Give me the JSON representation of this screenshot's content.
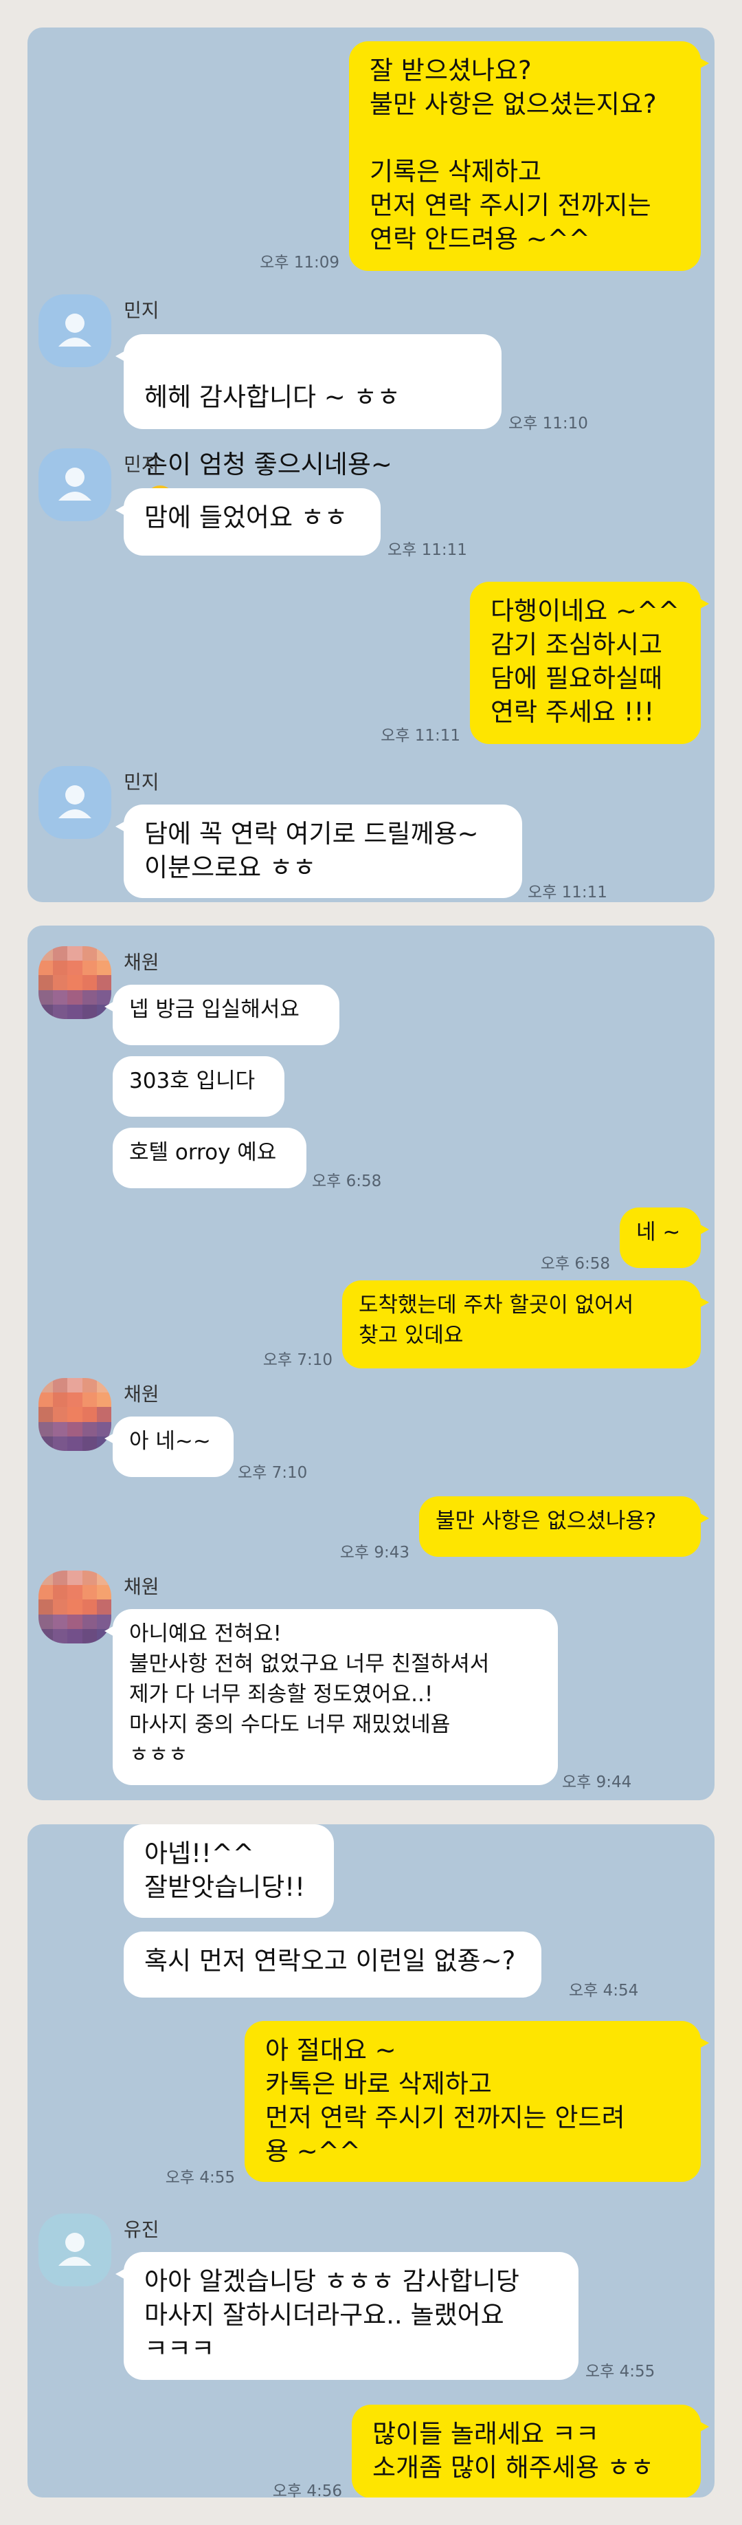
{
  "panel1": {
    "msg1": "잘 받으셨나요?\n불만 사항은 없으셨는지요?\n\n기록은 삭제하고\n먼저 연락 주시기 전까지는\n연락 안드려용 ~^^",
    "time1": "오후 11:09",
    "name1": "민지",
    "msg2a": "헤헤 감사합니다 ~ ㅎㅎ",
    "msg2b": "손이 엄청 좋으시네용~",
    "time2": "오후 11:10",
    "name2": "민지",
    "msg3": "맘에 들었어요 ㅎㅎ",
    "time3": "오후 11:11",
    "msg4": "다행이네요 ~^^\n감기 조심하시고\n담에 필요하실때\n연락 주세요 !!!",
    "time4": "오후 11:11",
    "name3": "민지",
    "msg5": "담에 꼭 연락 여기로 드릴께용~\n이분으로요 ㅎㅎ",
    "time5": "오후 11:11"
  },
  "panel2": {
    "name1": "채원",
    "msg1": "넵 방금 입실해서요",
    "msg2": "303호 입니다",
    "msg3": "호텔 orroy 예요",
    "time1": "오후 6:58",
    "msg4": "네 ~",
    "time2": "오후 6:58",
    "msg5": "도착했는데  주차 할곳이 없어서\n찾고 있데요",
    "time3": "오후 7:10",
    "name2": "채원",
    "msg6": "아 네~~",
    "time4": "오후 7:10",
    "msg7": "불만 사항은 없으셨나용?",
    "time5": "오후 9:43",
    "name3": "채원",
    "msg8": "아니예요 전혀요!\n불만사항 전혀 없었구요 너무 친절하셔서\n제가 다 너무 죄송할 정도였어요..!\n마사지 중의 수다도 너무 재밌었네욤\nㅎㅎㅎ",
    "time6": "오후 9:44"
  },
  "panel3": {
    "msg1": "아넵!!^^\n잘받앗습니당!!",
    "msg2": "혹시 먼저 연락오고 이런일 없죵~?",
    "time1": "오후 4:54",
    "msg3": "아 절대요 ~\n카톡은 바로 삭제하고\n먼저 연락 주시기 전까지는 안드려\n용 ~^^",
    "time2": "오후 4:55",
    "name1": "유진",
    "msg4": "아아 알겠습니당 ㅎㅎㅎ 감사합니당\n마사지 잘하시더라구요.. 놀랬어요\nㅋㅋㅋ",
    "time3": "오후 4:55",
    "msg5": "많이들 놀래세요 ㅋㅋ\n소개좀 많이 해주세용 ㅎㅎ",
    "time4": "오후 4:56"
  },
  "icons": {
    "default_avatar": "person-silhouette-icon",
    "emoji_tongue": "winking-tongue-emoji",
    "emoji_thumb": "thumbs-up-emoji"
  },
  "colors": {
    "chat_bg": "#b2c7d9",
    "my_bubble": "#fee500",
    "their_bubble": "#ffffff",
    "page_bg": "#ebe8e4"
  }
}
